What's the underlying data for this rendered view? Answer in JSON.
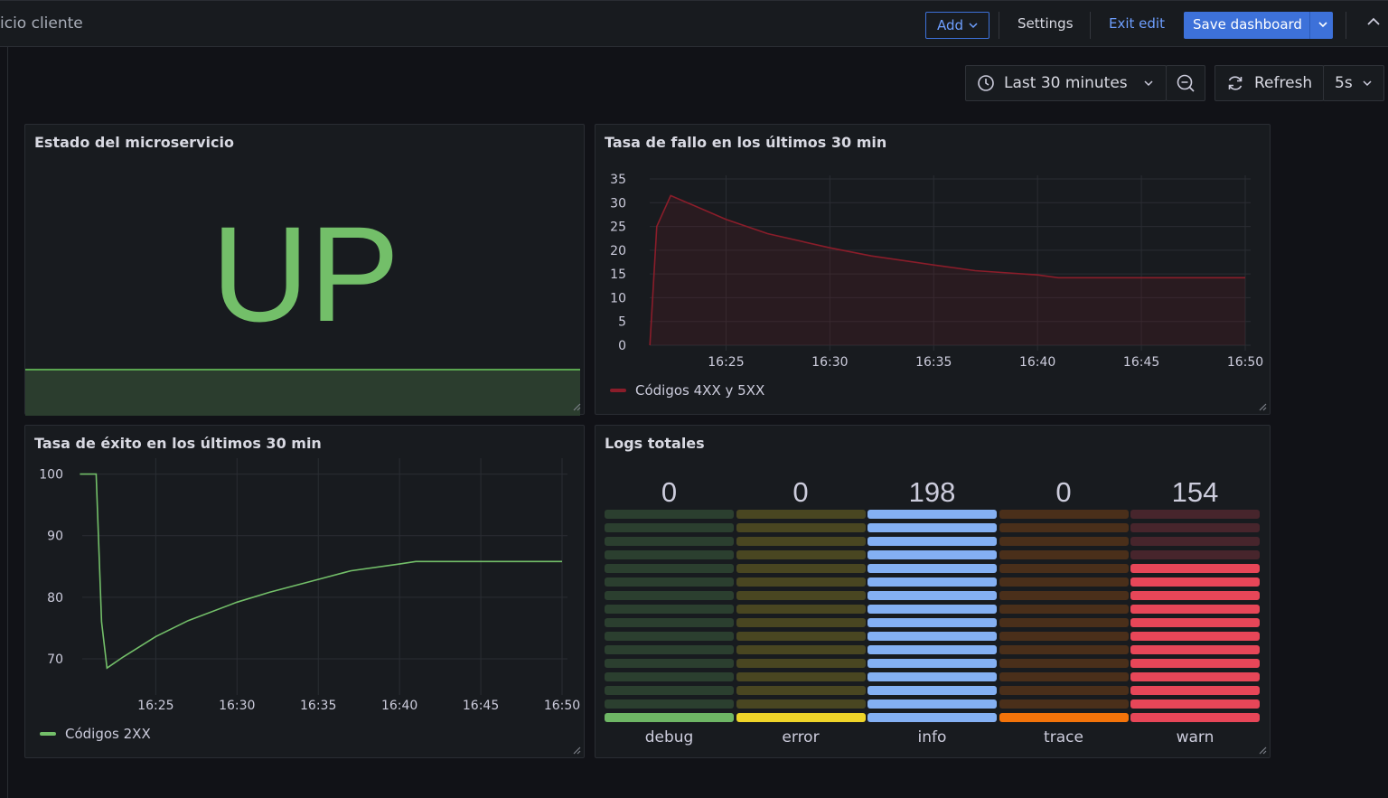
{
  "header": {
    "breadcrumb": "icio cliente",
    "add_label": "Add",
    "settings_label": "Settings",
    "exit_edit_label": "Exit edit",
    "save_label": "Save dashboard"
  },
  "controls": {
    "time_range": "Last 30 minutes",
    "refresh_label": "Refresh",
    "refresh_interval": "5s"
  },
  "colors": {
    "up": "#73bf69",
    "fail": "#8a1d2a",
    "success": "#73bf69",
    "accent": "#3d71d9"
  },
  "panels": {
    "status": {
      "title": "Estado del microservicio",
      "value": "UP"
    },
    "fail": {
      "title": "Tasa de fallo en los últimos 30 min",
      "legend": "Códigos 4XX y 5XX"
    },
    "success": {
      "title": "Tasa de éxito en los últimos 30 min",
      "legend": "Códigos 2XX"
    },
    "logs": {
      "title": "Logs totales"
    }
  },
  "chart_data": [
    {
      "type": "area",
      "title": "Tasa de fallo en los últimos 30 min",
      "x_ticks": [
        "16:25",
        "16:30",
        "16:35",
        "16:40",
        "16:45",
        "16:50"
      ],
      "y_ticks": [
        "35",
        "30",
        "25",
        "20",
        "15",
        "10",
        "5",
        "0"
      ],
      "ylim": [
        0,
        35
      ],
      "series": [
        {
          "name": "Códigos 4XX y 5XX",
          "x": [
            "16:21:20",
            "16:21:40",
            "16:22:20",
            "16:25",
            "16:27",
            "16:30",
            "16:32",
            "16:35",
            "16:37",
            "16:40",
            "16:41",
            "16:45",
            "16:50"
          ],
          "values": [
            0,
            25,
            31.5,
            26.5,
            23.5,
            20.5,
            18.8,
            16.9,
            15.7,
            14.8,
            14.2,
            14.2,
            14.2
          ]
        }
      ]
    },
    {
      "type": "line",
      "title": "Tasa de éxito en los últimos 30 min",
      "x_ticks": [
        "16:25",
        "16:30",
        "16:35",
        "16:40",
        "16:45",
        "16:50"
      ],
      "y_ticks": [
        "100",
        "90",
        "80",
        "70"
      ],
      "ylim": [
        65,
        102
      ],
      "series": [
        {
          "name": "Códigos 2XX",
          "x": [
            "16:20:20",
            "16:21:20",
            "16:21:40",
            "16:22",
            "16:23",
            "16:25",
            "16:27",
            "16:30",
            "16:32",
            "16:35",
            "16:37",
            "16:40",
            "16:41",
            "16:45",
            "16:50"
          ],
          "values": [
            100,
            100,
            76,
            68.5,
            70.3,
            73.6,
            76.2,
            79.2,
            80.8,
            82.9,
            84.3,
            85.4,
            85.8,
            85.8,
            85.8
          ]
        }
      ]
    },
    {
      "type": "bar",
      "title": "Logs totales",
      "categories": [
        "debug",
        "error",
        "info",
        "trace",
        "warn"
      ],
      "values": [
        0,
        0,
        198,
        0,
        154
      ],
      "max": 198,
      "colors": [
        "#73bf69",
        "#fade2a",
        "#8ab8ff",
        "#ff780a",
        "#f2495c"
      ]
    }
  ]
}
